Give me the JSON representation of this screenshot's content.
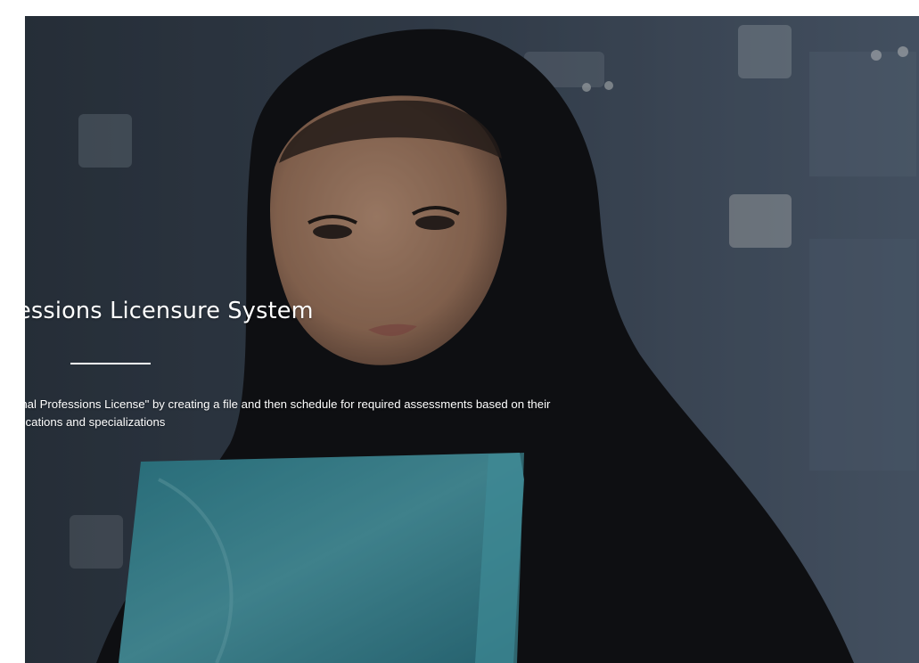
{
  "hero": {
    "title": "ofessions Licensure System",
    "description_line1": "onal Professions License\" by creating a file and then schedule for required assessments based on their",
    "description_line2": "ifications and specializations"
  },
  "background": {
    "subject": "woman-in-black-hijab-holding-teal-folder",
    "colors": {
      "backdrop": "#3a4656",
      "hijab": "#0b0b0d",
      "skin": "#b98a6e",
      "folder": "#3f9aa8"
    }
  }
}
